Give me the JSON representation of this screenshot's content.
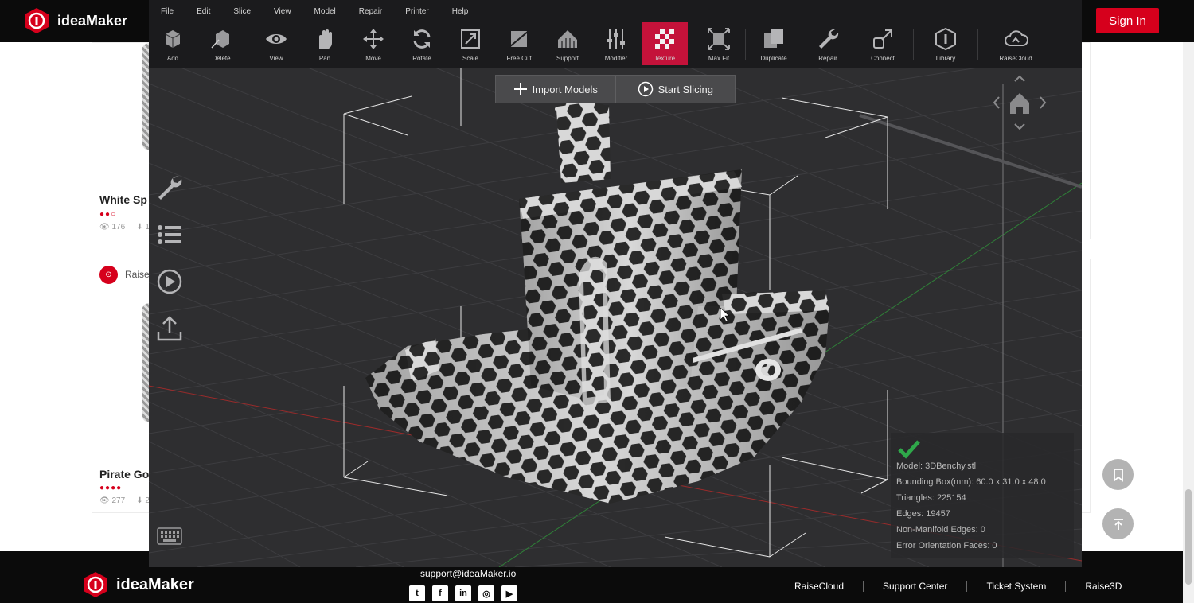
{
  "site": {
    "brand": "ideaMaker",
    "signin_label": "Sign In"
  },
  "cards": [
    {
      "title": "White Sp",
      "rating": "●●○",
      "views": "176",
      "downloads": "1"
    },
    {
      "brand": "Raise",
      "title": "Pirate Go",
      "rating": "●●●●",
      "views": "277",
      "downloads": "2"
    }
  ],
  "app": {
    "menu": [
      "File",
      "Edit",
      "Slice",
      "View",
      "Model",
      "Repair",
      "Printer",
      "Help"
    ],
    "tools": [
      {
        "label": "Add",
        "icon": "add-model-icon"
      },
      {
        "label": "Delete",
        "icon": "delete-model-icon"
      },
      {
        "label": "View",
        "icon": "eye-icon"
      },
      {
        "label": "Pan",
        "icon": "hand-icon"
      },
      {
        "label": "Move",
        "icon": "move-arrows-icon"
      },
      {
        "label": "Rotate",
        "icon": "rotate-icon"
      },
      {
        "label": "Scale",
        "icon": "scale-icon"
      },
      {
        "label": "Free Cut",
        "icon": "free-cut-icon"
      },
      {
        "label": "Support",
        "icon": "support-icon"
      },
      {
        "label": "Modifier",
        "icon": "sliders-icon"
      },
      {
        "label": "Texture",
        "icon": "checker-texture-icon",
        "active": true
      },
      {
        "label": "Max Fit",
        "icon": "max-fit-icon"
      },
      {
        "label": "Duplicate",
        "icon": "duplicate-icon"
      },
      {
        "label": "Repair",
        "icon": "wrench-icon"
      },
      {
        "label": "Connect",
        "icon": "connect-icon"
      },
      {
        "label": "Library",
        "icon": "library-icon"
      },
      {
        "label": "RaiseCloud",
        "icon": "cloud-icon"
      }
    ],
    "import_label": "Import Models",
    "slice_label": "Start Slicing",
    "model_info": {
      "model": "Model: 3DBenchy.stl",
      "bbox": "Bounding Box(mm): 60.0 x 31.0 x 48.0",
      "triangles": "Triangles: 225154",
      "edges": "Edges: 19457",
      "non_manifold": "Non-Manifold Edges: 0",
      "error_faces": "Error Orientation Faces: 0"
    },
    "accent": "#c4123a"
  },
  "footer": {
    "brand": "ideaMaker",
    "email": "support@ideaMaker.io",
    "socials": [
      "twitter-icon",
      "facebook-icon",
      "linkedin-icon",
      "instagram-icon",
      "youtube-icon"
    ],
    "links": [
      "RaiseCloud",
      "Support Center",
      "Ticket System",
      "Raise3D"
    ]
  }
}
